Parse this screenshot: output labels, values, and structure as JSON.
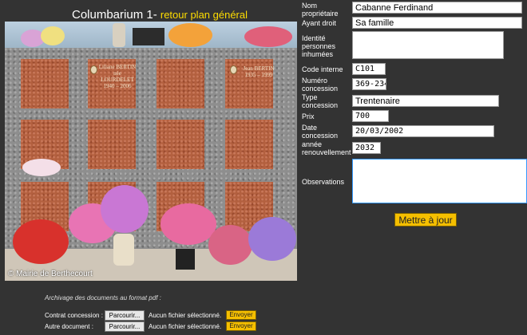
{
  "header": {
    "title": "Columbarium 1- ",
    "back_link": "retour plan général"
  },
  "photo": {
    "copyright": "© Mairie de Berthecourt",
    "plaque_left": "Liliane BERTIN\nnée LOURDELET\n1940 – 2006",
    "plaque_right": "Jean BERTIN\n1935 – 1999"
  },
  "form": {
    "owner": {
      "label": "Nom propriétaire",
      "value": "Cabanne Ferdinand"
    },
    "right_holder": {
      "label": "Ayant droit",
      "value": "Sa famille"
    },
    "identity": {
      "label": "Identité personnes inhumées",
      "value": ""
    },
    "internal_code": {
      "label": "Code interne",
      "value": "C101"
    },
    "concession_number": {
      "label": "Numéro concession",
      "value": "369-234"
    },
    "concession_type": {
      "label": "Type concession",
      "value": "Trentenaire"
    },
    "price": {
      "label": "Prix",
      "value": "700"
    },
    "concession_date": {
      "label": "Date concession",
      "value": "20/03/2002"
    },
    "renewal_year": {
      "label": "année renouvellement",
      "value": "2032"
    },
    "observations": {
      "label": "Observations",
      "value": ""
    },
    "update_button": "Mettre à jour"
  },
  "archive": {
    "intro": "Archivage des documents au format pdf :",
    "rows": [
      {
        "label": "Contrat concession :",
        "browse": "Parcourir...",
        "status": "Aucun fichier sélectionné.",
        "send": "Envoyer"
      },
      {
        "label": "Autre document :",
        "browse": "Parcourir...",
        "status": "Aucun fichier sélectionné.",
        "send": "Envoyer"
      }
    ]
  },
  "colors": {
    "background": "#333333",
    "accent_link": "#ffdd00",
    "button": "#f5bf00"
  }
}
